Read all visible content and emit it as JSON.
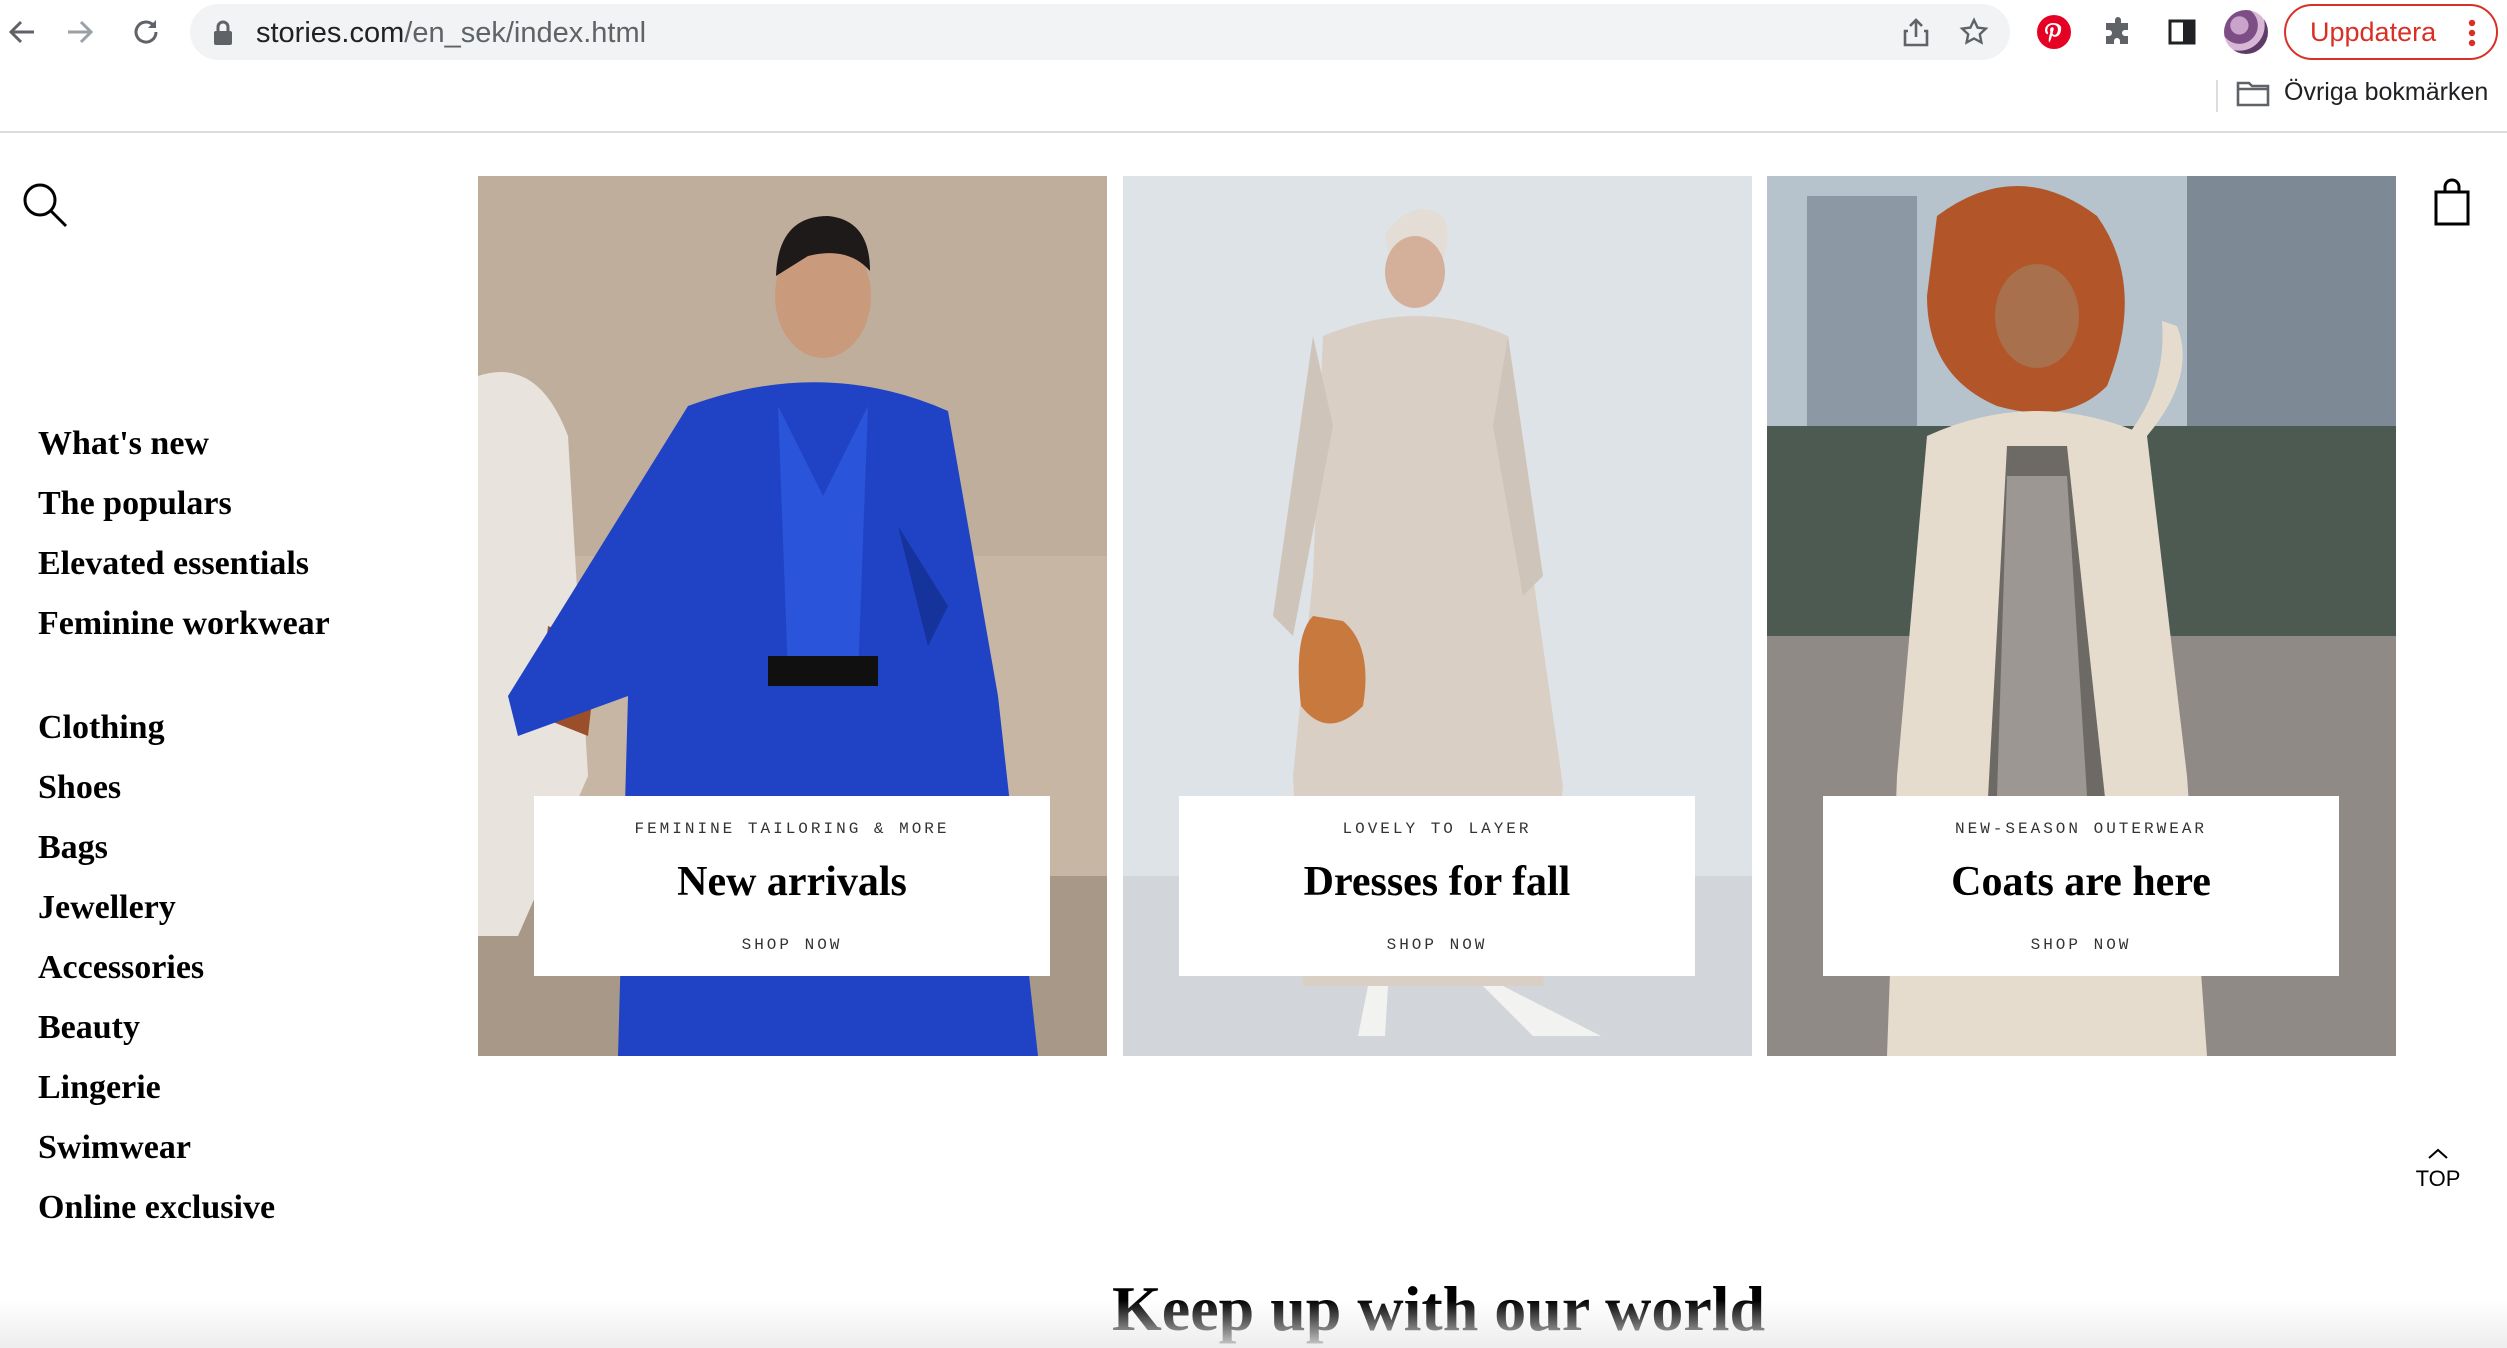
{
  "browser": {
    "url_host": "stories.com",
    "url_path": "/en_sek/index.html",
    "update_label": "Uppdatera",
    "bookmarks_folder": "Övriga bokmärken",
    "icons": [
      "back-icon",
      "forward-icon",
      "reload-icon",
      "lock-icon",
      "share-icon",
      "star-icon",
      "pinterest-icon",
      "extensions-icon",
      "side-panel-icon",
      "profile-avatar",
      "menu-dots-icon",
      "folder-icon"
    ]
  },
  "nav": {
    "primary": [
      "What's new",
      "The populars",
      "Elevated essentials",
      "Feminine workwear"
    ],
    "categories": [
      "Clothing",
      "Shoes",
      "Bags",
      "Jewellery",
      "Accessories",
      "Beauty",
      "Lingerie",
      "Swimwear",
      "Online exclusive"
    ]
  },
  "panels": [
    {
      "kicker": "FEMININE TAILORING & MORE",
      "title": "New arrivals",
      "cta": "SHOP NOW"
    },
    {
      "kicker": "LOVELY TO LAYER",
      "title": "Dresses for fall",
      "cta": "SHOP NOW"
    },
    {
      "kicker": "NEW-SEASON OUTERWEAR",
      "title": "Coats are here",
      "cta": "SHOP NOW"
    }
  ],
  "top_label": "TOP",
  "section_heading": "Keep up with our world",
  "colors": {
    "update_red": "#d93025",
    "pinterest_red": "#e60023",
    "suit_blue": "#1f43c4"
  }
}
